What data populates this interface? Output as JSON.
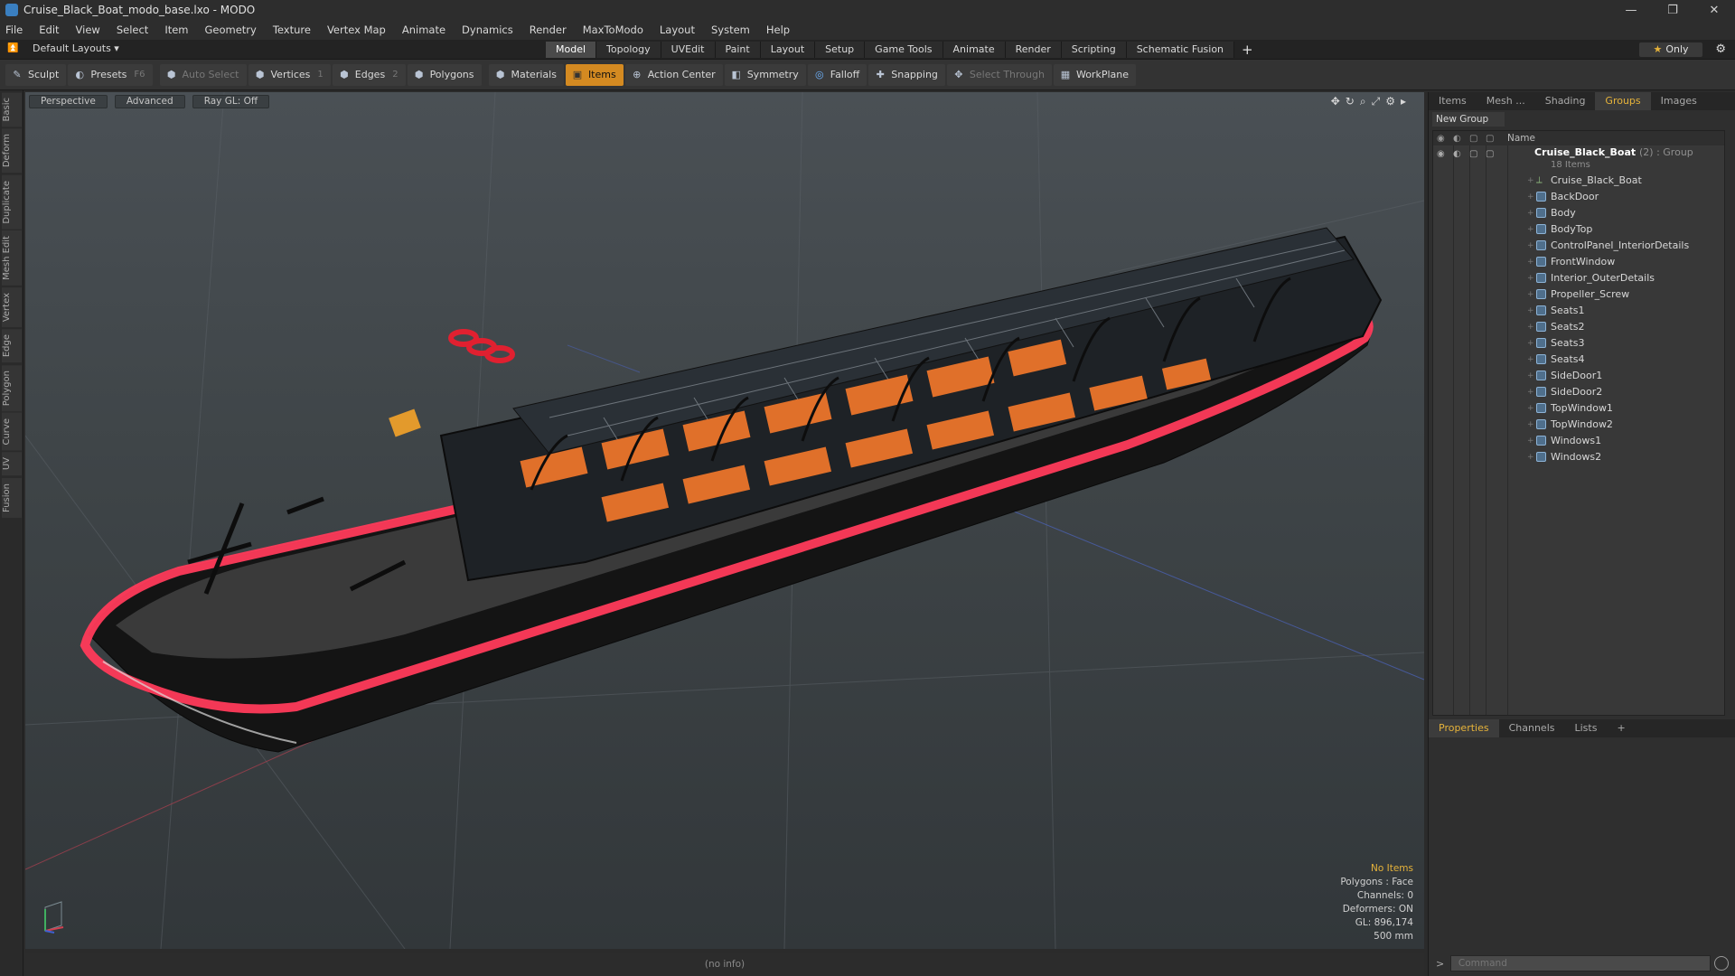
{
  "window": {
    "title": "Cruise_Black_Boat_modo_base.lxo - MODO",
    "controls": [
      "—",
      "❐",
      "✕"
    ]
  },
  "menu": [
    "File",
    "Edit",
    "View",
    "Select",
    "Item",
    "Geometry",
    "Texture",
    "Vertex Map",
    "Animate",
    "Dynamics",
    "Render",
    "MaxToModo",
    "Layout",
    "System",
    "Help"
  ],
  "layout_bar": {
    "layouts_label": "Default Layouts ▾",
    "tabs": [
      "Model",
      "Topology",
      "UVEdit",
      "Paint",
      "Layout",
      "Setup",
      "Game Tools",
      "Animate",
      "Render",
      "Scripting",
      "Schematic Fusion"
    ],
    "active_tab": "Model",
    "add_tab": "+",
    "only_star": "★",
    "only_label": "Only"
  },
  "toolbar": {
    "sculpt": "Sculpt",
    "presets": "Presets",
    "presets_key": "F6",
    "auto_select": "Auto Select",
    "vertices": "Vertices",
    "vertices_count": "1",
    "edges": "Edges",
    "edges_count": "2",
    "polygons": "Polygons",
    "materials": "Materials",
    "items": "Items",
    "action_center": "Action Center",
    "symmetry": "Symmetry",
    "falloff": "Falloff",
    "snapping": "Snapping",
    "select_through": "Select Through",
    "workplane": "WorkPlane"
  },
  "left_tabs": [
    "Basic",
    "Deform",
    "Duplicate",
    "Mesh Edit",
    "Vertex",
    "Edge",
    "Polygon",
    "Curve",
    "UV",
    "Fusion"
  ],
  "viewport": {
    "view_mode": "Perspective",
    "shading": "Advanced",
    "raygl": "Ray GL: Off",
    "info": {
      "no_items": "No Items",
      "polygons": "Polygons : Face",
      "channels": "Channels: 0",
      "deformers": "Deformers: ON",
      "gl": "GL: 896,174",
      "unit": "500 mm"
    }
  },
  "statusbar": {
    "text": "(no info)"
  },
  "right_panel": {
    "tabs": [
      "Items",
      "Mesh ...",
      "Shading",
      "Groups",
      "Images"
    ],
    "active_tab": "Groups",
    "new_group": "New Group",
    "tree_header": "Name",
    "group": {
      "name": "Cruise_Black_Boat",
      "meta": "(2) : Group",
      "count": "18 Items"
    },
    "items": [
      "Cruise_Black_Boat",
      "BackDoor",
      "Body",
      "BodyTop",
      "ControlPanel_InteriorDetails",
      "FrontWindow",
      "Interior_OuterDetails",
      "Propeller_Screw",
      "Seats1",
      "Seats2",
      "Seats3",
      "Seats4",
      "SideDoor1",
      "SideDoor2",
      "TopWindow1",
      "TopWindow2",
      "Windows1",
      "Windows2"
    ],
    "bottom_tabs": [
      "Properties",
      "Channels",
      "Lists"
    ],
    "bottom_active": "Properties",
    "command_placeholder": "Command"
  },
  "colors": {
    "accent": "#e6b33a",
    "active_tool": "#d48a21",
    "boat_stripe": "#ff3a5a",
    "boat_hull": "#141414",
    "seat_orange": "#e0702a"
  }
}
